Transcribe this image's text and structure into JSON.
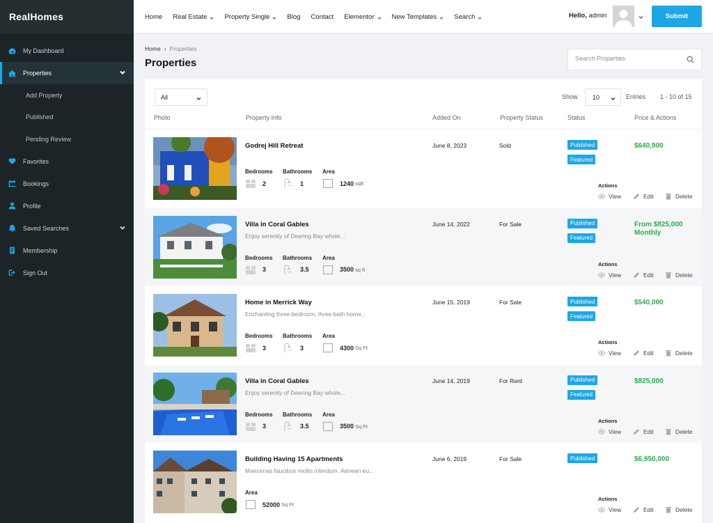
{
  "brand": "RealHomes",
  "sidebar": {
    "items": [
      {
        "label": "My Dashboard",
        "icon": "dashboard-icon"
      },
      {
        "label": "Properties",
        "icon": "home-icon",
        "active": true
      },
      {
        "label": "Add Property"
      },
      {
        "label": "Published"
      },
      {
        "label": "Pending Review"
      },
      {
        "label": "Favorites",
        "icon": "heart-icon"
      },
      {
        "label": "Bookings",
        "icon": "calendar-icon"
      },
      {
        "label": "Profile",
        "icon": "user-icon"
      },
      {
        "label": "Saved Searches",
        "icon": "bell-icon"
      },
      {
        "label": "Membership",
        "icon": "membership-icon"
      },
      {
        "label": "Sign Out",
        "icon": "sign-out-icon"
      }
    ]
  },
  "topnav": {
    "items": [
      "Home",
      "Real Estate",
      "Property Single",
      "Blog",
      "Contact",
      "Elementor",
      "New Templates",
      "Search"
    ],
    "hello_prefix": "Hello,",
    "user": "admin",
    "submit_label": "Submit"
  },
  "breadcrumb": {
    "home": "Home",
    "sep": "›",
    "current": "Properties"
  },
  "page_title": "Properties",
  "search": {
    "placeholder": "Search Properties"
  },
  "table": {
    "filter_value": "All",
    "show_label": "Show",
    "entries_value": "10",
    "entries_label": "Entries",
    "range": "1 - 10 of 15",
    "headers": [
      "Photo",
      "Property Info",
      "Added On",
      "Property Status",
      "Status",
      "Price & Actions"
    ],
    "labels": {
      "bedrooms": "Bedrooms",
      "bathrooms": "Bathrooms",
      "area": "Area",
      "actions": "Actions",
      "view": "View",
      "edit": "Edit",
      "delete": "Delete"
    },
    "rows": [
      {
        "title": "Godrej Hill Retreat",
        "desc": "",
        "bedrooms": "2",
        "bathrooms": "1",
        "area": "1240",
        "area_unit": "sqft",
        "added": "June 8, 2023",
        "status": "Sold",
        "badges": [
          "Published",
          "Featured"
        ],
        "price": "$640,900",
        "price2": ""
      },
      {
        "title": "Villa in Coral Gables",
        "desc": "Enjoy serenity of Deering Bay whole...",
        "bedrooms": "3",
        "bathrooms": "3.5",
        "area": "3500",
        "area_unit": "sq ft",
        "added": "June 14, 2022",
        "status": "For Sale",
        "badges": [
          "Published",
          "Featured"
        ],
        "price": "From $825,000",
        "price2": "Monthly"
      },
      {
        "title": "Home in Merrick Way",
        "desc": "Enchanting three bedroom, three bath home...",
        "bedrooms": "3",
        "bathrooms": "3",
        "area": "4300",
        "area_unit": "Sq Ft",
        "added": "June 15, 2019",
        "status": "For Sale",
        "badges": [
          "Published",
          "Featured"
        ],
        "price": "$540,000",
        "price2": ""
      },
      {
        "title": "Villa in Coral Gables",
        "desc": "Enjoy serenity of Deering Bay whole...",
        "bedrooms": "3",
        "bathrooms": "3.5",
        "area": "3500",
        "area_unit": "Sq Ft",
        "added": "June 14, 2019",
        "status": "For Rent",
        "badges": [
          "Published",
          "Featured"
        ],
        "price": "$825,000",
        "price2": ""
      },
      {
        "title": "Building Having 15 Apartments",
        "desc": "Maecenas faucibus mollis interdum. Aenean eu...",
        "bedrooms": "",
        "bathrooms": "",
        "area": "52000",
        "area_unit": "Sq Ft",
        "added": "June 6, 2019",
        "status": "For Sale",
        "badges": [
          "Published"
        ],
        "price": "$6,950,000",
        "price2": ""
      }
    ]
  },
  "colors": {
    "accent": "#1ea7e6",
    "price": "#27ae4d",
    "sidebar_bg": "#1c2427"
  }
}
